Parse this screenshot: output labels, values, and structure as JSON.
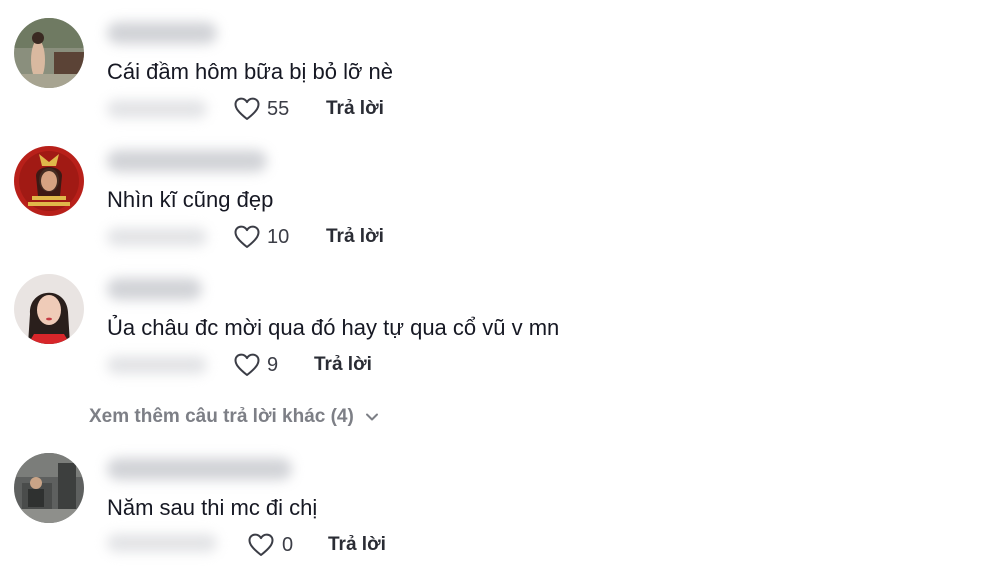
{
  "comments": [
    {
      "text": "Cái đầm hôm bữa bị bỏ lỡ nè",
      "likes": "55",
      "reply_label": "Trả lời",
      "avatar_icon": "user-avatar-photo"
    },
    {
      "text": "Nhìn kĩ cũng đẹp",
      "likes": "10",
      "reply_label": "Trả lời",
      "avatar_icon": "user-avatar-photo"
    },
    {
      "text": "Ủa châu đc mời qua đó hay tự qua cổ vũ v mn",
      "likes": "9",
      "reply_label": "Trả lời",
      "avatar_icon": "user-avatar-photo"
    },
    {
      "text": "Năm sau thi mc đi chị",
      "likes": "0",
      "reply_label": "Trả lời",
      "avatar_icon": "user-avatar-photo"
    }
  ],
  "view_more": {
    "label": "Xem thêm câu trả lời khác (4)",
    "icon": "chevron-down-icon"
  },
  "icons": {
    "like": "heart-outline-icon"
  },
  "colors": {
    "text_primary": "#161823",
    "text_secondary": "#7d7f86",
    "blurred_placeholder": "#c9cbd0"
  }
}
